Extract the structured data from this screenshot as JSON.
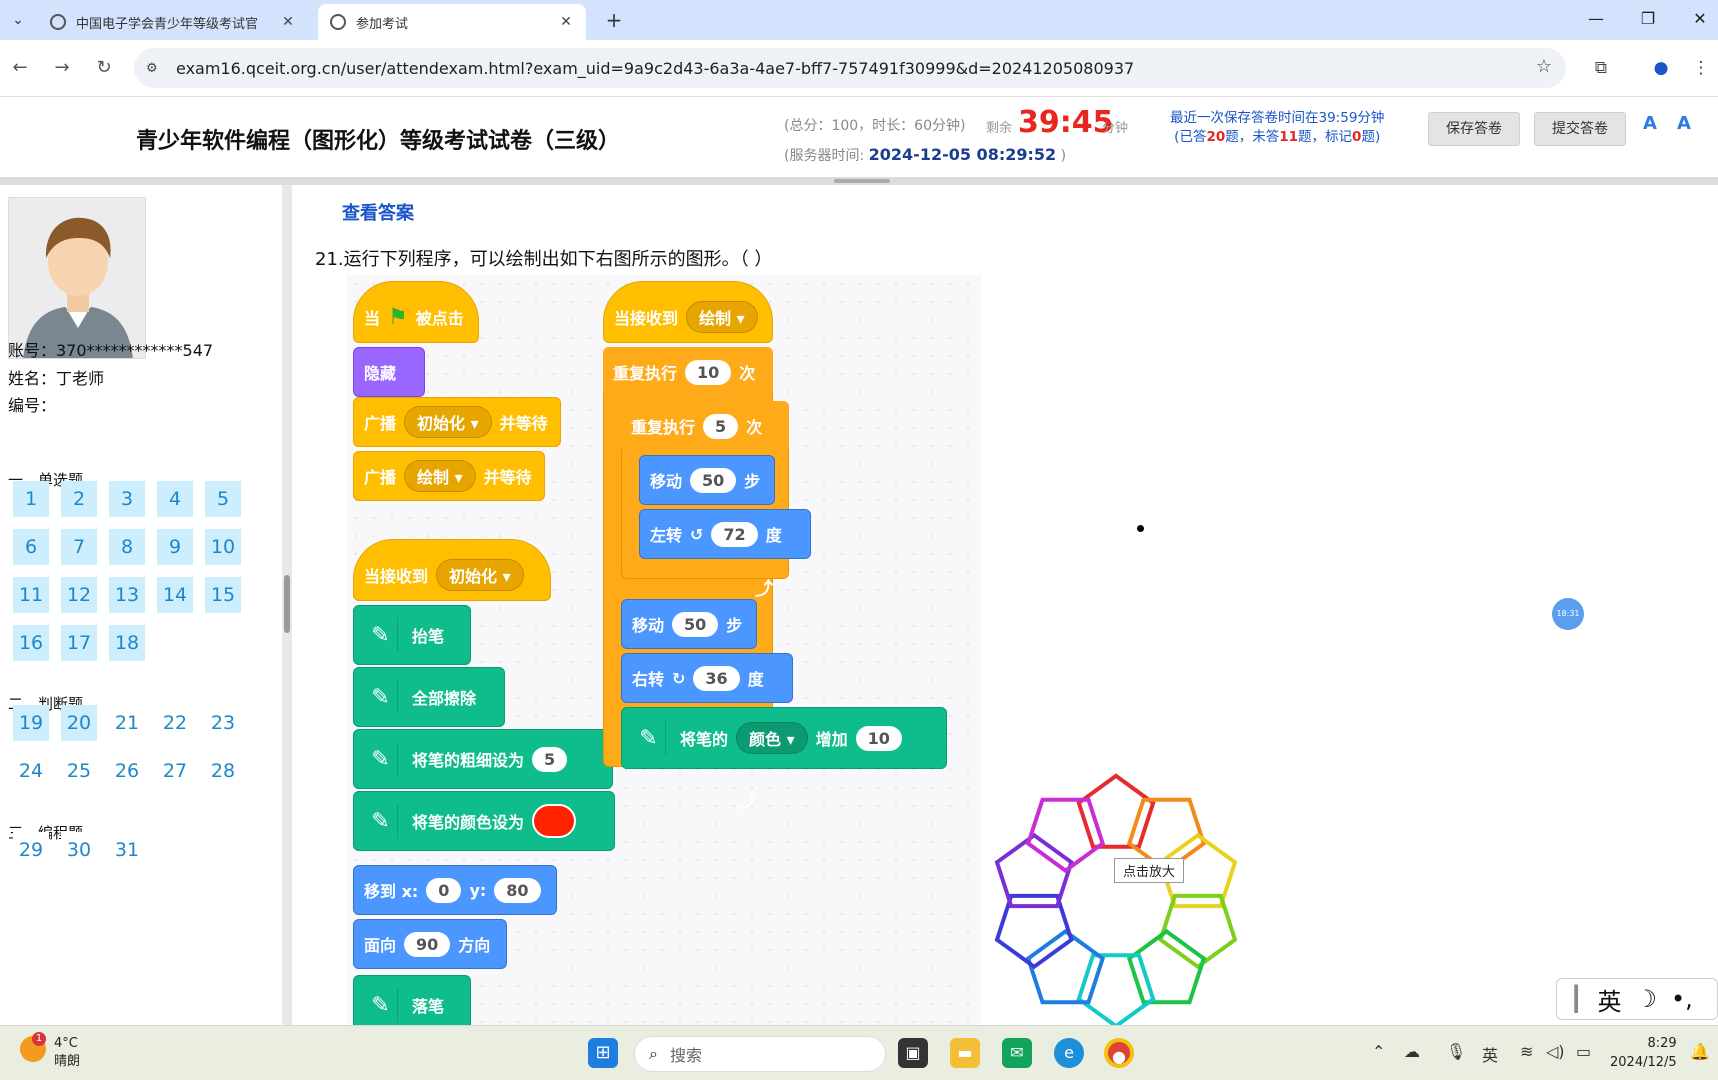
{
  "browser": {
    "tabs": [
      {
        "title": "中国电子学会青少年等级考试官"
      },
      {
        "title": "参加考试"
      }
    ],
    "url": "exam16.qceit.org.cn/user/attendexam.html?exam_uid=9a9c2d43-6a3a-4ae7-bff7-757491f30999&d=20241205080937"
  },
  "header": {
    "title": "青少年软件编程（图形化）等级考试试卷（三级）",
    "meta": "(总分：100，时长：60分钟)",
    "remain_label": "剩余",
    "timer": "39:45",
    "timer_unit": "分钟",
    "server_label": "(服务器时间:",
    "server_time": "2024-12-05 08:29:52",
    "server_close": ")",
    "save_line1": "最近一次保存答卷时间在39:59分钟",
    "save_line2_a": "(已答",
    "answered": "20",
    "save_line2_b": "题，未答",
    "unanswered": "11",
    "save_line2_c": "题，标记",
    "marked": "0",
    "save_line2_d": "题)",
    "save_button": "保存答卷",
    "submit_button": "提交答卷"
  },
  "sidebar": {
    "account": "账号：370************547",
    "name": "姓名：丁老师",
    "number": "编号：",
    "sections": [
      {
        "title": "一、单选题",
        "questions": [
          "1",
          "2",
          "3",
          "4",
          "5",
          "6",
          "7",
          "8",
          "9",
          "10",
          "11",
          "12",
          "13",
          "14",
          "15",
          "16",
          "17",
          "18"
        ]
      },
      {
        "title": "二、判断题",
        "questions": [
          "19",
          "20",
          "21",
          "22",
          "23",
          "24",
          "25",
          "26",
          "27",
          "28"
        ]
      },
      {
        "title": "三、编程题",
        "questions": [
          "29",
          "30",
          "31"
        ]
      }
    ]
  },
  "content": {
    "view_answer": "查看答案",
    "question": "21.运行下列程序，可以绘制出如下右图所示的图形。（ ）",
    "zoom_tip": "点击放大",
    "float_ball": "18:31",
    "flower_colors": [
      "#e52b2b",
      "#f28a1c",
      "#e8d21e",
      "#7ccf1a",
      "#19c447",
      "#14c9c9",
      "#1f7de0",
      "#3b3bd8",
      "#7a2fd6",
      "#c72fd4"
    ]
  },
  "blocks": {
    "green_flag_hat": {
      "pre": "当",
      "post": "被点击"
    },
    "hide": "隐藏",
    "broadcast_wait_1": {
      "label": "广播",
      "msg": "初始化 ▾",
      "suffix": "并等待"
    },
    "broadcast_wait_2": {
      "label": "广播",
      "msg": "绘制 ▾",
      "suffix": "并等待"
    },
    "receive_init": {
      "label": "当接收到",
      "msg": "初始化 ▾"
    },
    "pen_up": "抬笔",
    "clear": "全部擦除",
    "set_size": {
      "label": "将笔的粗细设为",
      "value": "5"
    },
    "set_color": "将笔的颜色设为",
    "goto": {
      "label": "移到 x:",
      "x": "0",
      "ylabel": "y:",
      "y": "80"
    },
    "point_dir": {
      "label": "面向",
      "value": "90",
      "suffix": "方向"
    },
    "pen_down": "落笔",
    "receive_draw": {
      "label": "当接收到",
      "msg": "绘制 ▾"
    },
    "repeat_outer": {
      "label": "重复执行",
      "value": "10",
      "suffix": "次"
    },
    "repeat_inner": {
      "label": "重复执行",
      "value": "5",
      "suffix": "次"
    },
    "move_inner": {
      "label": "移动",
      "value": "50",
      "suffix": "步"
    },
    "turn_left": {
      "label": "左转",
      "icon": "↺",
      "value": "72",
      "suffix": "度"
    },
    "move_outer": {
      "label": "移动",
      "value": "50",
      "suffix": "步"
    },
    "turn_right": {
      "label": "右转",
      "icon": "↻",
      "value": "36",
      "suffix": "度"
    },
    "change_pen": {
      "label": "将笔的",
      "param": "颜色 ▾",
      "op": "增加",
      "value": "10"
    }
  },
  "taskbar": {
    "temp": "4°C",
    "weather": "晴朗",
    "badge": "1",
    "search": "搜索",
    "ime": "英",
    "time": "8:29",
    "date": "2024/12/5"
  }
}
